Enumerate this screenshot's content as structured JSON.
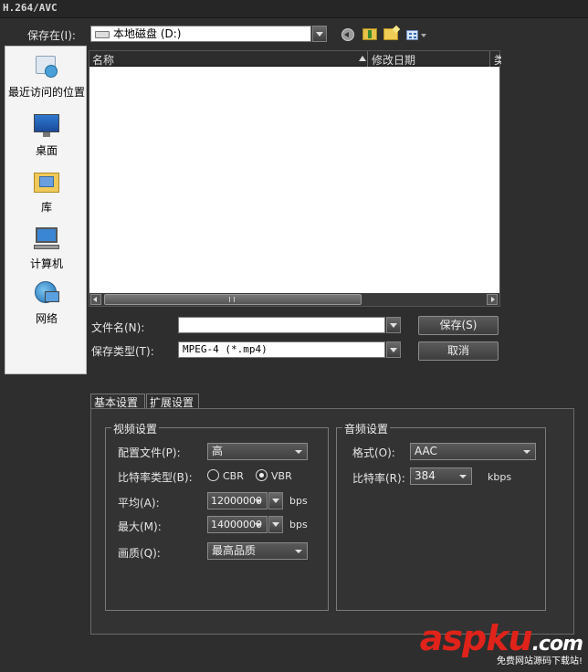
{
  "window": {
    "title": "H.264/AVC"
  },
  "save_in": {
    "label": "保存在(I):",
    "value": "本地磁盘 (D:)"
  },
  "toolbar_icons": [
    "back-icon",
    "up-folder-icon",
    "new-folder-icon",
    "view-menu-icon"
  ],
  "places": [
    {
      "label": "最近访问的位置",
      "icon": "recent-places-icon"
    },
    {
      "label": "桌面",
      "icon": "desktop-icon"
    },
    {
      "label": "库",
      "icon": "library-icon"
    },
    {
      "label": "计算机",
      "icon": "computer-icon"
    },
    {
      "label": "网络",
      "icon": "network-icon"
    }
  ],
  "file_list": {
    "columns": {
      "name": "名称",
      "modified": "修改日期",
      "extra": "类"
    }
  },
  "filename": {
    "label": "文件名(N):",
    "value": ""
  },
  "filetype": {
    "label": "保存类型(T):",
    "value": "MPEG-4 (*.mp4)"
  },
  "buttons": {
    "save": "保存(S)",
    "cancel": "取消"
  },
  "tabs": {
    "basic": "基本设置",
    "extended": "扩展设置"
  },
  "video": {
    "group_title": "视频设置",
    "profile_label": "配置文件(P):",
    "profile_value": "高",
    "bitrate_type_label": "比特率类型(B):",
    "cbr_label": "CBR",
    "vbr_label": "VBR",
    "selected": "VBR",
    "avg_label": "平均(A):",
    "avg_value": "12000000",
    "avg_unit": "bps",
    "max_label": "最大(M):",
    "max_value": "14000000",
    "max_unit": "bps",
    "quality_label": "画质(Q):",
    "quality_value": "最高品质"
  },
  "audio": {
    "group_title": "音频设置",
    "format_label": "格式(O):",
    "format_value": "AAC",
    "bitrate_label": "比特率(R):",
    "bitrate_value": "384",
    "bitrate_unit": "kbps"
  },
  "watermark": {
    "main": "aspku",
    "tld": ".com",
    "sub": "免费网站源码下载站!"
  },
  "colors": {
    "watermark_red": "#e0231a",
    "dialog_bg": "#2e2e2e"
  }
}
